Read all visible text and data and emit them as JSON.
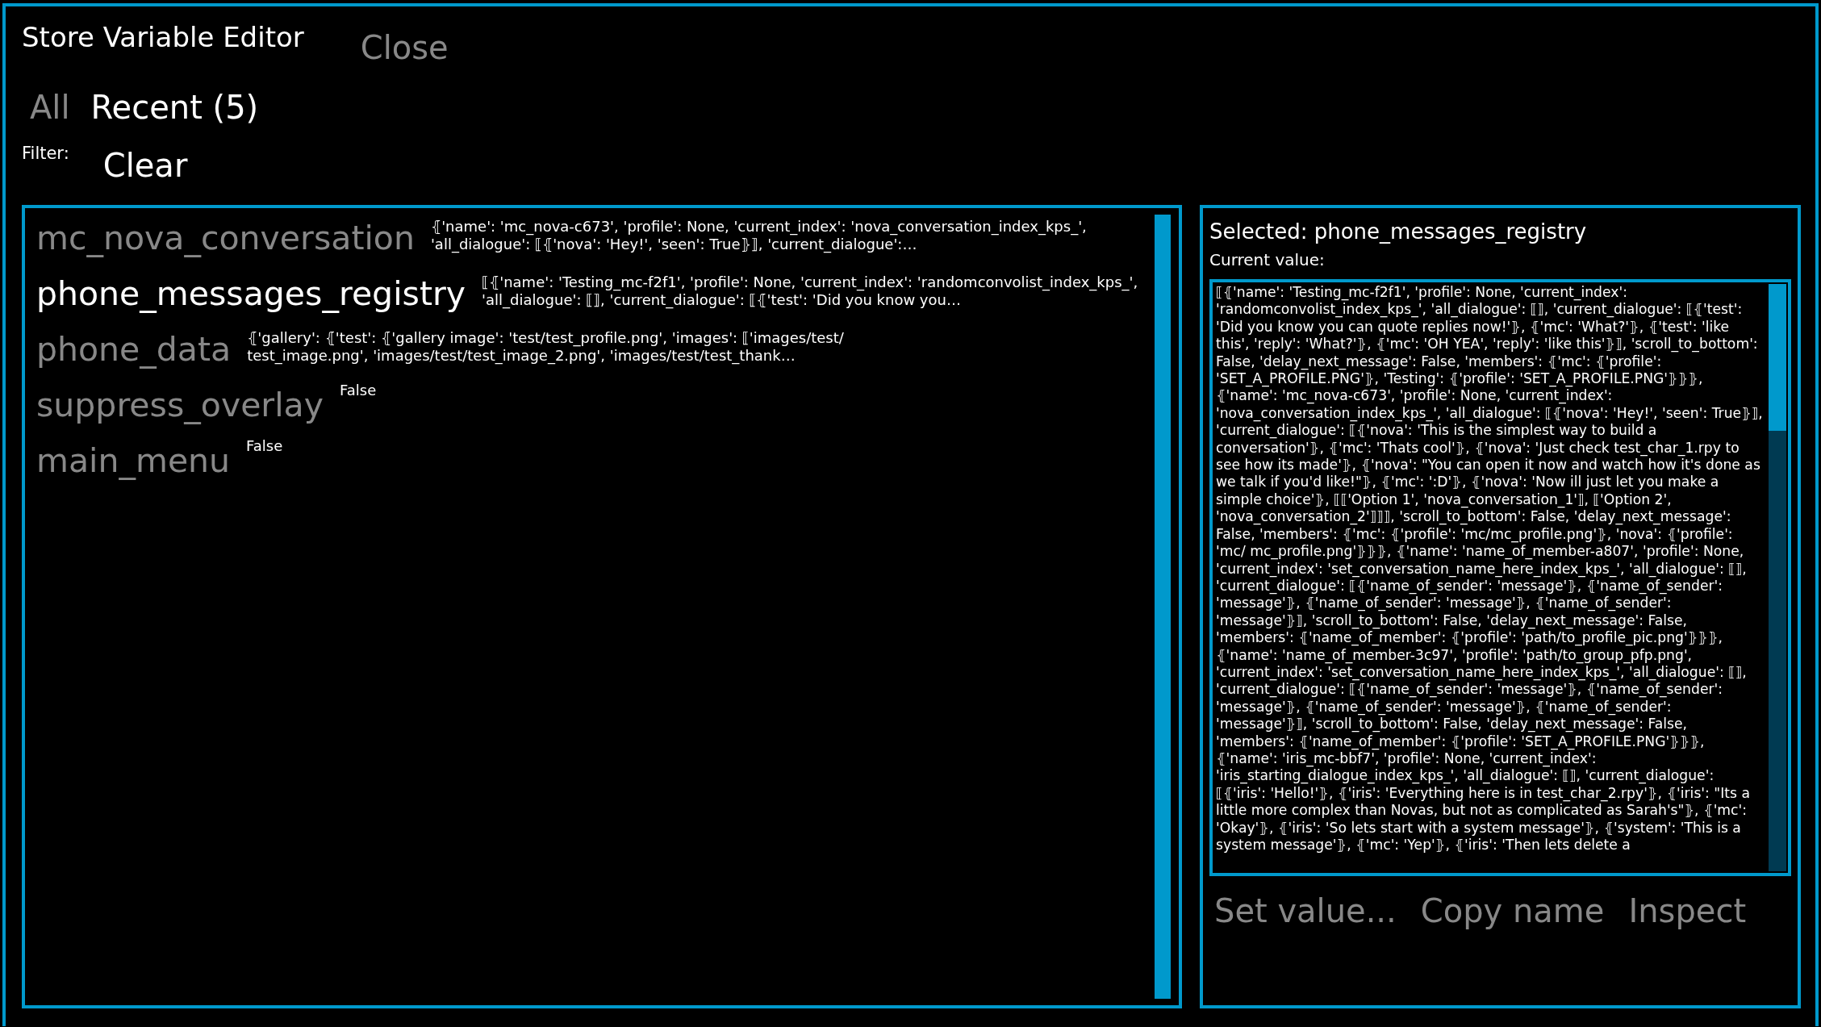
{
  "window": {
    "title": "Store Variable Editor",
    "close": "Close"
  },
  "tabs": [
    {
      "label": "All",
      "selected": false
    },
    {
      "label": "Recent (5)",
      "selected": true
    }
  ],
  "filter": {
    "label": "Filter:",
    "clear": "Clear"
  },
  "variables": [
    {
      "name": "mc_nova_conversation",
      "value": "⦃'name': 'mc_nova-c673', 'profile': None, 'current_index': 'nova_conversation_index_kps_', 'all_dialogue': ⟦⦃'nova': 'Hey!', 'seen': True⦄⟧, 'current_dialogue':…",
      "selected": false
    },
    {
      "name": "phone_messages_registry",
      "value": "⟦⦃'name': 'Testing_mc-f2f1', 'profile': None, 'current_index': 'randomconvolist_index_kps_', 'all_dialogue': ⟦⟧, 'current_dialogue': ⟦⦃'test': 'Did you know you…",
      "selected": true
    },
    {
      "name": "phone_data",
      "value": "⦃'gallery': ⦃'test': ⦃'gallery image': 'test/test_profile.png', 'images': ⟦'images/test/ test_image.png', 'images/test/test_image_2.png', 'images/test/test_thank…",
      "selected": false
    },
    {
      "name": "suppress_overlay",
      "value": "False",
      "selected": false
    },
    {
      "name": "main_menu",
      "value": "False",
      "selected": false
    }
  ],
  "detail": {
    "selected_label": "Selected: phone_messages_registry",
    "current_value_label": "Current value:",
    "current_value": "⟦⦃'name': 'Testing_mc-f2f1', 'profile': None, 'current_index': 'randomconvolist_index_kps_', 'all_dialogue': ⟦⟧, 'current_dialogue': ⟦⦃'test': 'Did you know you can quote replies now!'⦄, ⦃'mc': 'What?'⦄, ⦃'test': 'like this', 'reply': 'What?'⦄, ⦃'mc': 'OH YEA', 'reply': 'like this'⦄⟧, 'scroll_to_bottom': False, 'delay_next_message': False, 'members': ⦃'mc': ⦃'profile': 'SET_A_PROFILE.PNG'⦄, 'Testing': ⦃'profile': 'SET_A_PROFILE.PNG'⦄⦄⦄, ⦃'name': 'mc_nova-c673', 'profile': None, 'current_index': 'nova_conversation_index_kps_', 'all_dialogue': ⟦⦃'nova': 'Hey!', 'seen': True⦄⟧, 'current_dialogue': ⟦⦃'nova': 'This is the simplest way to build a conversation'⦄, ⦃'mc': 'Thats cool'⦄, ⦃'nova': 'Just check test_char_1.rpy to see how its made'⦄, ⦃'nova': \"You can open it now and watch how it's done as we talk if you'd like!\"⦄, ⦃'mc': ':D'⦄, ⦃'nova': 'Now ill just let you make a simple choice'⦄, ⟦⟦'Option 1', 'nova_conversation_1'⟧, ⟦'Option 2', 'nova_conversation_2'⟧⟧⟧, 'scroll_to_bottom': False, 'delay_next_message': False, 'members': ⦃'mc': ⦃'profile': 'mc/mc_profile.png'⦄, 'nova': ⦃'profile': 'mc/ mc_profile.png'⦄⦄⦄, ⦃'name': 'name_of_member-a807', 'profile': None, 'current_index': 'set_conversation_name_here_index_kps_', 'all_dialogue': ⟦⟧, 'current_dialogue': ⟦⦃'name_of_sender': 'message'⦄, ⦃'name_of_sender': 'message'⦄, ⦃'name_of_sender': 'message'⦄, ⦃'name_of_sender': 'message'⦄⟧, 'scroll_to_bottom': False, 'delay_next_message': False, 'members': ⦃'name_of_member': ⦃'profile': 'path/to_profile_pic.png'⦄⦄⦄, ⦃'name': 'name_of_member-3c97', 'profile': 'path/to_group_pfp.png', 'current_index': 'set_conversation_name_here_index_kps_', 'all_dialogue': ⟦⟧, 'current_dialogue': ⟦⦃'name_of_sender': 'message'⦄, ⦃'name_of_sender': 'message'⦄, ⦃'name_of_sender': 'message'⦄, ⦃'name_of_sender': 'message'⦄⟧, 'scroll_to_bottom': False, 'delay_next_message': False, 'members': ⦃'name_of_member': ⦃'profile': 'SET_A_PROFILE.PNG'⦄⦄⦄, ⦃'name': 'iris_mc-bbf7', 'profile': None, 'current_index': 'iris_starting_dialogue_index_kps_', 'all_dialogue': ⟦⟧, 'current_dialogue': ⟦⦃'iris': 'Hello!'⦄, ⦃'iris': 'Everything here is in test_char_2.rpy'⦄, ⦃'iris': \"Its a little more complex than Novas, but not as complicated as Sarah's\"⦄, ⦃'mc': 'Okay'⦄, ⦃'iris': 'So lets start with a system message'⦄, ⦃'system': 'This is a system message'⦄, ⦃'mc': 'Yep'⦄, ⦃'iris': 'Then lets delete a",
    "actions": [
      "Set value...",
      "Copy name",
      "Inspect"
    ]
  }
}
